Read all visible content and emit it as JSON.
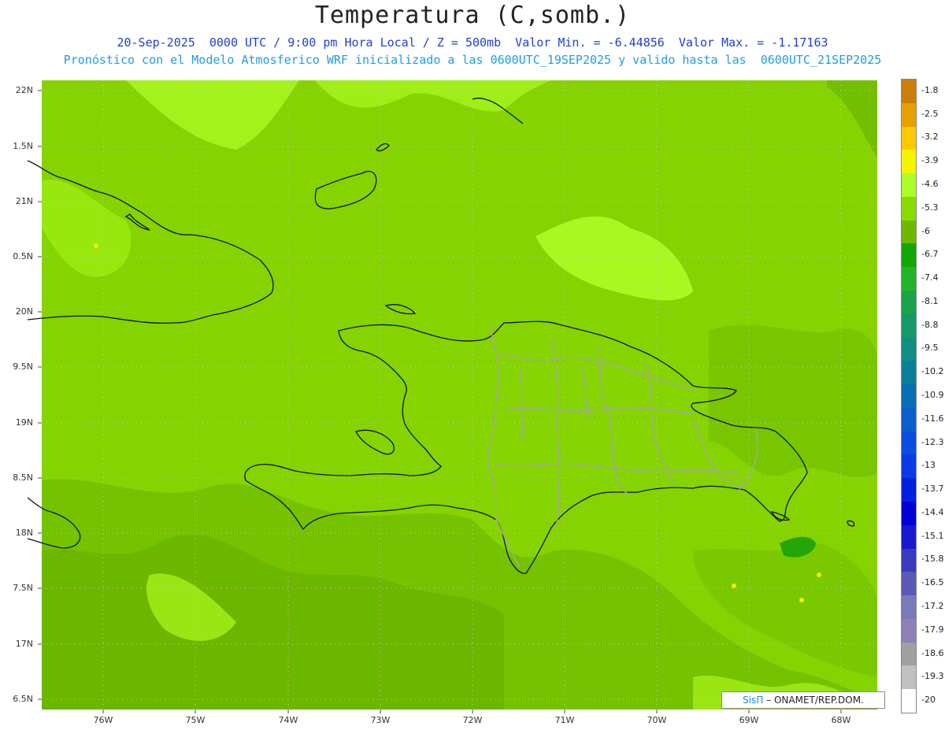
{
  "header": {
    "title": "Temperatura (C,somb.)",
    "subtitle_line1": "20-Sep-2025  0000 UTC / 9:00 pm Hora Local / Z = 500mb  Valor Min. = -6.44856  Valor Max. = -1.17163",
    "subtitle_line2": "Pronóstico con el Modelo Atmosferico WRF inicializado a las 0600UTC_19SEP2025 y valido hasta las  0600UTC_21SEP2025"
  },
  "axes": {
    "lat_labels": [
      "22N",
      "1.5N",
      "21N",
      "0.5N",
      "20N",
      "9.5N",
      "19N",
      "8.5N",
      "18N",
      "7.5N",
      "17N",
      "6.5N"
    ],
    "lon_labels": [
      "76W",
      "75W",
      "74W",
      "73W",
      "72W",
      "71W",
      "70W",
      "69W",
      "68W"
    ]
  },
  "legend": {
    "labels": [
      "-1.8",
      "-2.5",
      "-3.2",
      "-3.9",
      "-4.6",
      "-5.3",
      "-6",
      "-6.7",
      "-7.4",
      "-8.1",
      "-8.8",
      "-9.5",
      "-10.2",
      "-10.9",
      "-11.6",
      "-12.3",
      "-13",
      "-13.7",
      "-14.4",
      "-15.1",
      "-15.8",
      "-16.5",
      "-17.2",
      "-17.9",
      "-18.6",
      "-19.3",
      "-20"
    ],
    "colors": [
      "#c97f0a",
      "#e6a000",
      "#ffc800",
      "#f4f400",
      "#aaff28",
      "#8adb00",
      "#6eb800",
      "#12a600",
      "#22b52a",
      "#1aa348",
      "#129a68",
      "#0e8f82",
      "#0a7f9a",
      "#0a6fb2",
      "#0a5fcc",
      "#0a4ee0",
      "#0a3ae6",
      "#0020e0",
      "#0000d6",
      "#1a1acc",
      "#3a3abc",
      "#5a5ab6",
      "#7a7ab8",
      "#9080b8",
      "#a0a0a0",
      "#c0c0c0",
      "#ffffff"
    ]
  },
  "colors": {
    "field_light": "#8edc06",
    "field_mid": "#7ecb00",
    "field_dark": "#6fbb00",
    "field_bright": "#aaff28"
  },
  "credit": {
    "brand": "SisΠ",
    "text": " – ONAMET/REP.DOM."
  }
}
